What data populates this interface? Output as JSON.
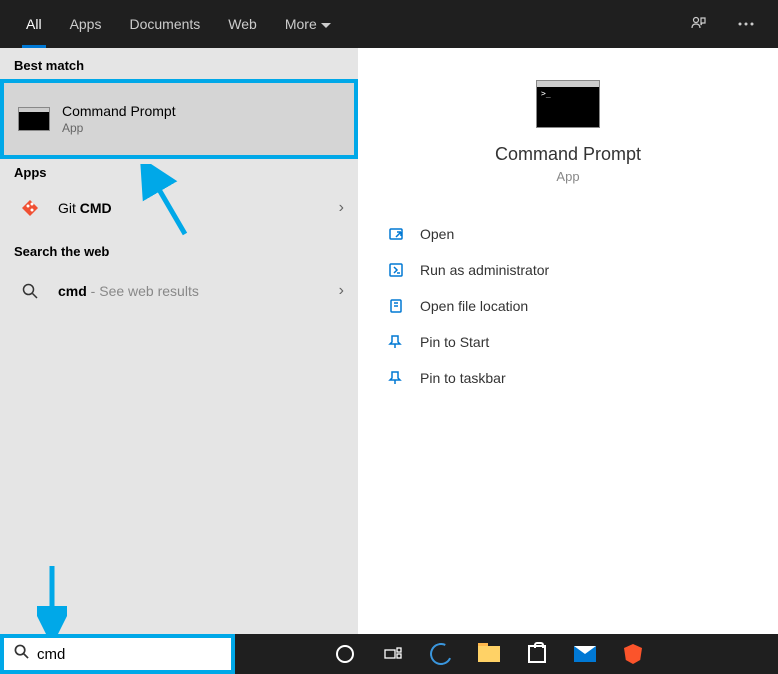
{
  "tabs": {
    "all": "All",
    "apps": "Apps",
    "documents": "Documents",
    "web": "Web",
    "more": "More"
  },
  "sections": {
    "best_match": "Best match",
    "apps": "Apps",
    "search_web": "Search the web"
  },
  "best_result": {
    "title": "Command Prompt",
    "subtitle": "App"
  },
  "app_results": [
    {
      "title_prefix": "Git ",
      "title_bold": "CMD"
    }
  ],
  "web_results": [
    {
      "query": "cmd",
      "suffix": " - See web results"
    }
  ],
  "detail": {
    "title": "Command Prompt",
    "subtitle": "App",
    "actions": {
      "open": "Open",
      "run_admin": "Run as administrator",
      "open_location": "Open file location",
      "pin_start": "Pin to Start",
      "pin_taskbar": "Pin to taskbar"
    }
  },
  "search": {
    "value": "cmd"
  }
}
